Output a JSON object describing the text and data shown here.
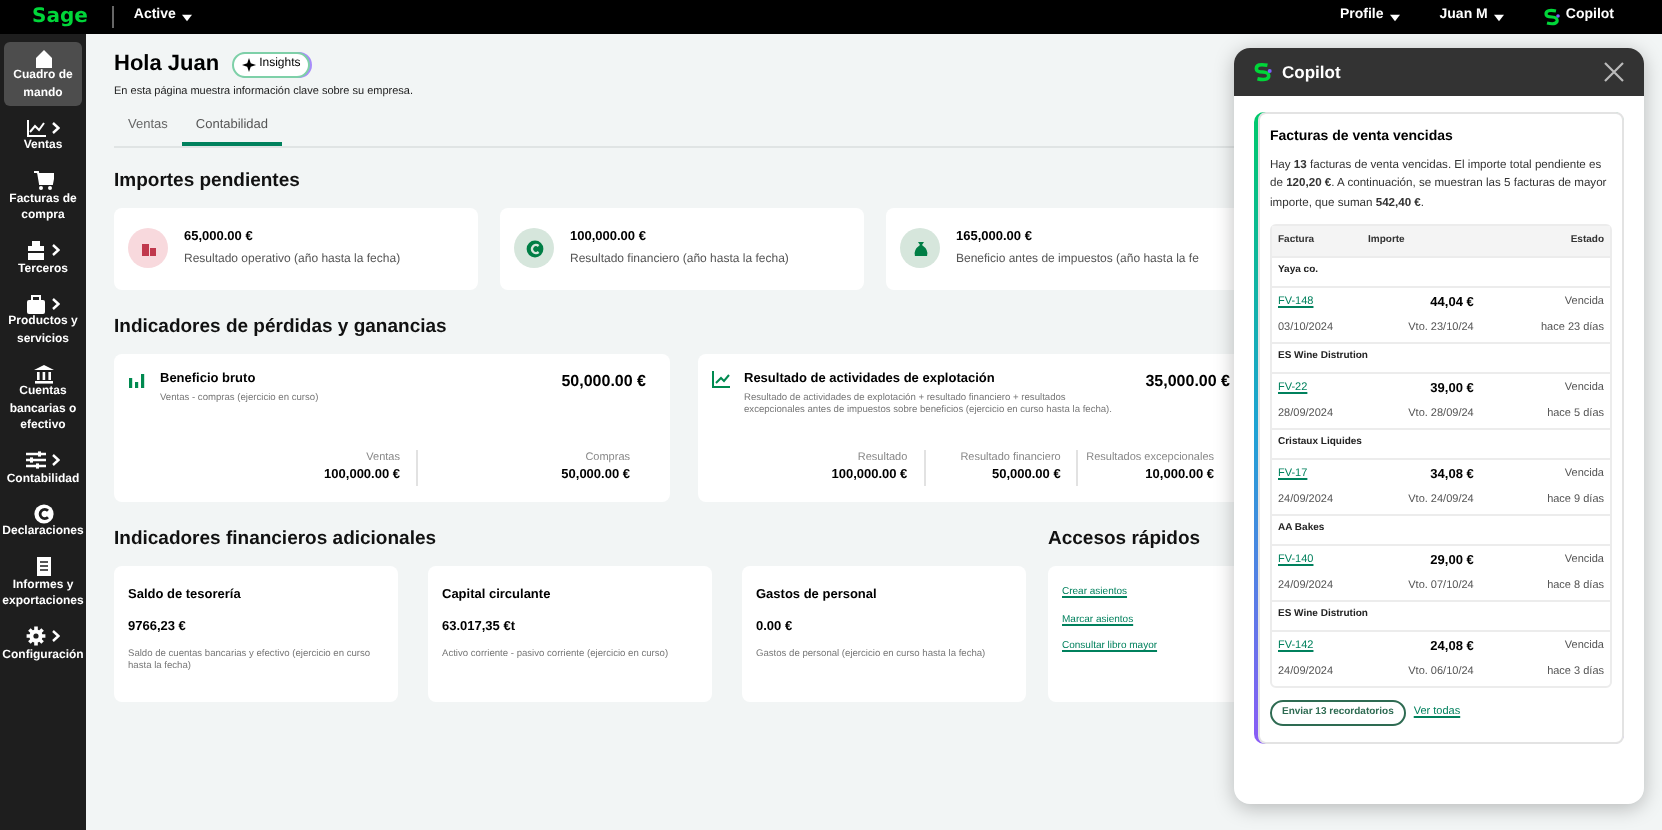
{
  "topbar": {
    "logo": "Sage",
    "company": "Active",
    "menus": [
      {
        "label": "Profile"
      },
      {
        "label": "Juan M"
      }
    ],
    "copilot": "Copilot"
  },
  "sidebar": {
    "items": [
      {
        "label": "Cuadro de mando",
        "selected": true,
        "expandable": false
      },
      {
        "label": "Ventas",
        "selected": false,
        "expandable": true
      },
      {
        "label": "Facturas de compra",
        "selected": false,
        "expandable": false
      },
      {
        "label": "Terceros",
        "selected": false,
        "expandable": true
      },
      {
        "label": "Productos y servicios",
        "selected": false,
        "expandable": true
      },
      {
        "label": "Cuentas bancarias o efectivo",
        "selected": false,
        "expandable": false
      },
      {
        "label": "Contabilidad",
        "selected": false,
        "expandable": true
      },
      {
        "label": "Declaraciones",
        "selected": false,
        "expandable": false
      },
      {
        "label": "Informes y exportaciones",
        "selected": false,
        "expandable": false
      },
      {
        "label": "Configuración",
        "selected": false,
        "expandable": true
      }
    ]
  },
  "header": {
    "greeting": "Hola Juan",
    "badge": "Insights",
    "subtitle": "En esta página muestra información clave sobre su empresa."
  },
  "tabs": [
    {
      "label": "Ventas",
      "selected": false
    },
    {
      "label": "Contabilidad",
      "selected": true
    }
  ],
  "pending": {
    "title": "Importes pendientes",
    "cards": [
      {
        "amount": "65,000.00 €",
        "label": "Resultado operativo (año hasta la fecha)",
        "color": "#f8d9dd"
      },
      {
        "amount": "100,000.00 €",
        "label": "Resultado financiero (año hasta la fecha)",
        "color": "#d6e6dc"
      },
      {
        "amount": "165,000.00 €",
        "label": "Beneficio antes de impuestos (año hasta la fe",
        "color": "#d6e6dc"
      }
    ]
  },
  "pl": {
    "title": "Indicadores de pérdidas y ganancias",
    "cards": [
      {
        "title": "Beneficio bruto",
        "value": "50,000.00 €",
        "description": "Ventas - compras (ejercicio en curso)",
        "metrics": [
          {
            "label": "Ventas",
            "value": "100,000.00 €"
          },
          {
            "label": "Compras",
            "value": "50,000.00 €"
          }
        ]
      },
      {
        "title": "Resultado de actividades de explotación",
        "value": "35,000.00 €",
        "description": "Resultado de actividades de explotación + resultado financiero + resultados excepcionales antes de impuestos sobre beneficios (ejercicio en curso hasta la fecha).",
        "metrics": [
          {
            "label": "Resultado",
            "value": "100,000.00 €"
          },
          {
            "label": "Resultado financiero",
            "value": "50,000.00 €"
          },
          {
            "label": "Resultados excepcionales",
            "value": "10,000.00 €"
          }
        ]
      }
    ]
  },
  "financial": {
    "title": "Indicadores financieros adicionales",
    "cards": [
      {
        "title": "Saldo de tesorería",
        "value": "9766,23 €",
        "description": "Saldo de cuentas bancarias y efectivo (ejercicio en curso hasta la fecha)"
      },
      {
        "title": "Capital circulante",
        "value": "63.017,35 €t",
        "description": "Activo corriente - pasivo corriente (ejercicio en curso)"
      },
      {
        "title": "Gastos de personal",
        "value": "0.00 €",
        "description": "Gastos de personal (ejercicio en curso hasta la fecha)"
      }
    ]
  },
  "quick_access": {
    "title": "Accesos rápidos",
    "links": [
      "Crear asientos",
      "Marcar asientos",
      "Consultar libro mayor"
    ]
  },
  "copilot_panel": {
    "title": "Copilot",
    "card_title": "Facturas de venta vencidas",
    "intro": "Hay **13** facturas de venta vencidas. El importe total pendiente es de **120,20 €**. A continuación, se muestran las 5 facturas de mayor importe, que suman **542,40 €**.",
    "columns": [
      "Factura",
      "Importe",
      "Estado"
    ],
    "groups": [
      {
        "customer": "Yaya co.",
        "invoices": [
          {
            "number": "FV-148",
            "date": "03/10/2024",
            "amount": "44,04 €",
            "due": "Vto. 23/10/24",
            "status": "Vencida",
            "age": "hace 23 días"
          }
        ]
      },
      {
        "customer": "ES Wine Distrution",
        "invoices": [
          {
            "number": "FV-22",
            "date": "28/09/2024",
            "amount": "39,00 €",
            "due": "Vto. 28/09/24",
            "status": "Vencida",
            "age": "hace 5 días"
          }
        ]
      },
      {
        "customer": "Cristaux Liquides",
        "invoices": [
          {
            "number": "FV-17",
            "date": "24/09/2024",
            "amount": "34,08 €",
            "due": "Vto. 24/09/24",
            "status": "Vencida",
            "age": "hace 9 días"
          }
        ]
      },
      {
        "customer": "AA Bakes",
        "invoices": [
          {
            "number": "FV-140",
            "date": "24/09/2024",
            "amount": "29,00 €",
            "due": "Vto. 07/10/24",
            "status": "Vencida",
            "age": "hace 8 días"
          }
        ]
      },
      {
        "customer": "ES Wine Distrution",
        "invoices": [
          {
            "number": "FV-142",
            "date": "24/09/2024",
            "amount": "24,08 €",
            "due": "Vto. 06/10/24",
            "status": "Vencida",
            "age": "hace 3 días"
          }
        ]
      }
    ],
    "send_button": "Enviar 13 recordatorios",
    "view_all": "Ver todas"
  }
}
